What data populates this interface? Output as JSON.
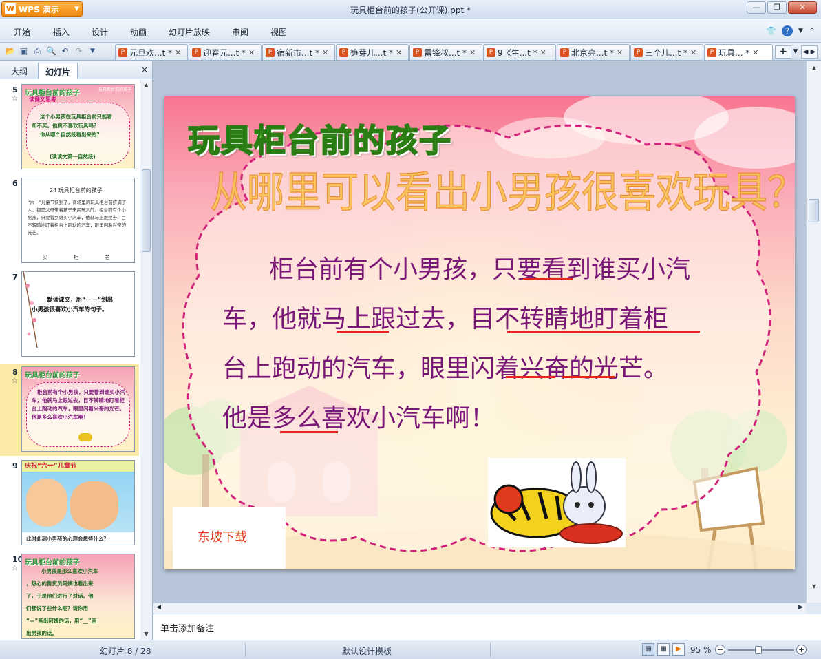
{
  "app": {
    "brand": "WPS 演示",
    "window_title": "玩具柜台前的孩子(公开课).ppt *"
  },
  "menu": [
    "开始",
    "插入",
    "设计",
    "动画",
    "幻灯片放映",
    "审阅",
    "视图"
  ],
  "doc_tabs": [
    {
      "label": "元旦欢...t *"
    },
    {
      "label": "迎春元...t *"
    },
    {
      "label": "宿新市...t *"
    },
    {
      "label": "笋芽儿...t *"
    },
    {
      "label": "雷锋叔...t *"
    },
    {
      "label": "9《生...t *"
    },
    {
      "label": "北京亮...t *"
    },
    {
      "label": "三个儿...t *"
    },
    {
      "label": "玩具... *",
      "active": true
    }
  ],
  "left_panel": {
    "tab_outline": "大纲",
    "tab_slides": "幻灯片",
    "close": "×",
    "thumbnails": [
      {
        "num": "5",
        "title": "玩具柜台前的孩子",
        "subtitle": "读课文思考",
        "lines": [
          "这个小男孩在玩具柜台前只能看",
          "却不买。他真不喜欢玩具吗？",
          "你从哪个自然段看出来的？",
          "(读读文第一自然段)"
        ],
        "corner": "玩具柜台前的孩子"
      },
      {
        "num": "6",
        "heading": "24  玩具柜台前的孩子",
        "paragraph": "“六一”儿童节快到了，商场里的玩具柜台前挤满了人，都是父母带着孩子来买玩具的。柜台前有个小男孩，只要看到谁买小汽车，他就马上跟过去，目不转睛地盯着柜台上跑动的汽车，眼里闪着兴奋的光芒。",
        "footer": "买  柜  芒"
      },
      {
        "num": "7",
        "lines": [
          "默读课文，用“——”划出",
          "小男孩很喜欢小汽车的句子。"
        ]
      },
      {
        "num": "8",
        "title": "玩具柜台前的孩子",
        "lines": [
          "柜台前有个小男孩，只要看到谁买小汽",
          "车，他就马上跟过去，目不转睛地盯着柜",
          "台上跑动的汽车，眼里闪着兴奋的光芒。",
          "他是多么喜欢小汽车啊！"
        ]
      },
      {
        "num": "9",
        "banner": "庆祝“六一”儿童节",
        "caption": "此时此刻小男孩的心理会想些什么？"
      },
      {
        "num": "10",
        "title": "玩具柜台前的孩子",
        "lines": [
          "小男孩是那么喜欢小汽车",
          "，热心的售货员阿姨也看出来",
          "了，于是他们进行了对话。他",
          "们都说了些什么呢？请你用",
          "“—”画出阿姨的话，用“__”画",
          "出男孩的话。"
        ]
      }
    ]
  },
  "slide": {
    "title": "玩具柜台前的孩子",
    "question": "从哪里可以看出小男孩很喜欢玩具？",
    "body_lines": [
      "柜台前有个小男孩，只要看到谁买小汽",
      "车，他就马上跟过去，目不转睛地盯着柜",
      "台上跑动的汽车，眼里闪着兴奋的光芒。",
      "他是多么喜欢小汽车啊！"
    ],
    "watermark": "东坡下载"
  },
  "notes_placeholder": "单击添加备注",
  "status": {
    "slide_counter": "幻灯片 8 / 28",
    "template": "默认设计模板",
    "zoom": "95 %"
  },
  "colors": {
    "accent": "#f08a10",
    "slide_text": "#7a1877",
    "underline": "#e8231b",
    "cloud_border": "#d0237a"
  }
}
